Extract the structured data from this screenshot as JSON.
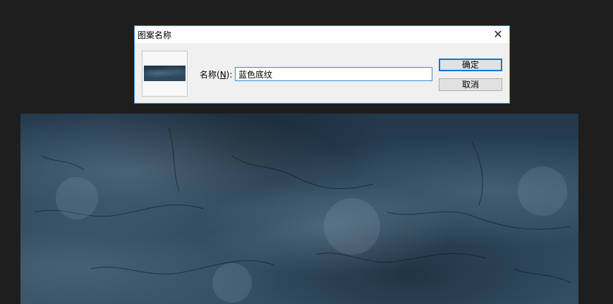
{
  "dialog": {
    "title": "图案名称",
    "name_label_prefix": "名称(",
    "name_label_mnemonic": "N",
    "name_label_suffix": "):",
    "name_value": "蓝色底纹",
    "ok_label": "确定",
    "cancel_label": "取消"
  },
  "icons": {
    "close": "close-icon"
  },
  "colors": {
    "workspace_bg": "#1e1e1e",
    "dialog_border": "#4a90d0",
    "focus_blue": "#0078d7",
    "texture_base": "#2b455a"
  }
}
